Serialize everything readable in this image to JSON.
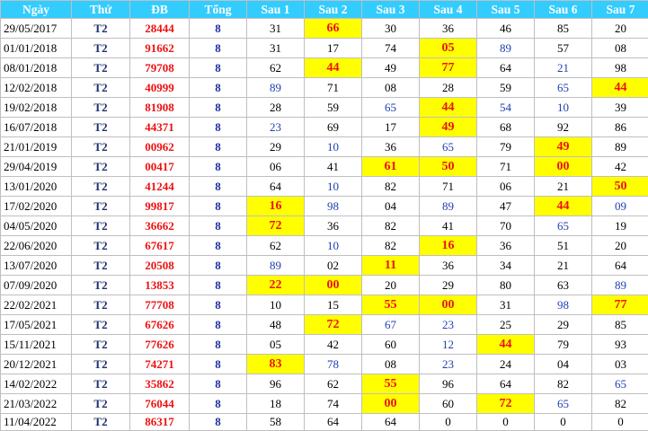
{
  "columns": [
    "Ngày",
    "Thứ",
    "ĐB",
    "Tổng",
    "Sau 1",
    "Sau 2",
    "Sau 3",
    "Sau 4",
    "Sau 5",
    "Sau 6",
    "Sau 7"
  ],
  "colors": {
    "header_bg": "#33ccff",
    "highlight_bg": "#ffff00",
    "highlight_text": "#ee1111",
    "db_text": "#ee1111",
    "tong_text": "#1f2fa0",
    "blue_number": "#1f3fb0"
  },
  "rows": [
    {
      "date": "29/05/2017",
      "thu": "T2",
      "db": "28444",
      "tong": "8",
      "sau": [
        "31",
        "66",
        "30",
        "36",
        "46",
        "85",
        "20"
      ],
      "hl": [
        1
      ],
      "blue": []
    },
    {
      "date": "01/01/2018",
      "thu": "T2",
      "db": "91662",
      "tong": "8",
      "sau": [
        "31",
        "17",
        "74",
        "05",
        "89",
        "57",
        "08"
      ],
      "hl": [
        3
      ],
      "blue": [
        4
      ]
    },
    {
      "date": "08/01/2018",
      "thu": "T2",
      "db": "79708",
      "tong": "8",
      "sau": [
        "62",
        "44",
        "49",
        "77",
        "64",
        "21",
        "98"
      ],
      "hl": [
        1,
        3
      ],
      "blue": [
        5
      ]
    },
    {
      "date": "12/02/2018",
      "thu": "T2",
      "db": "40999",
      "tong": "8",
      "sau": [
        "89",
        "71",
        "08",
        "28",
        "59",
        "65",
        "44"
      ],
      "hl": [
        6
      ],
      "blue": [
        0,
        5
      ]
    },
    {
      "date": "19/02/2018",
      "thu": "T2",
      "db": "81908",
      "tong": "8",
      "sau": [
        "28",
        "59",
        "65",
        "44",
        "54",
        "10",
        "39"
      ],
      "hl": [
        3
      ],
      "blue": [
        2,
        4,
        5
      ]
    },
    {
      "date": "16/07/2018",
      "thu": "T2",
      "db": "44371",
      "tong": "8",
      "sau": [
        "23",
        "69",
        "17",
        "49",
        "68",
        "92",
        "86"
      ],
      "hl": [
        3
      ],
      "blue": [
        0
      ]
    },
    {
      "date": "21/01/2019",
      "thu": "T2",
      "db": "00962",
      "tong": "8",
      "sau": [
        "29",
        "10",
        "36",
        "65",
        "79",
        "49",
        "89"
      ],
      "hl": [
        5
      ],
      "blue": [
        1,
        3
      ]
    },
    {
      "date": "29/04/2019",
      "thu": "T2",
      "db": "00417",
      "tong": "8",
      "sau": [
        "06",
        "41",
        "61",
        "50",
        "71",
        "00",
        "42"
      ],
      "hl": [
        2,
        3,
        5
      ],
      "blue": []
    },
    {
      "date": "13/01/2020",
      "thu": "T2",
      "db": "41244",
      "tong": "8",
      "sau": [
        "64",
        "10",
        "82",
        "71",
        "06",
        "21",
        "50"
      ],
      "hl": [
        6
      ],
      "blue": [
        1
      ]
    },
    {
      "date": "17/02/2020",
      "thu": "T2",
      "db": "99817",
      "tong": "8",
      "sau": [
        "16",
        "98",
        "04",
        "89",
        "47",
        "44",
        "09"
      ],
      "hl": [
        0,
        5
      ],
      "blue": [
        1,
        3,
        6
      ]
    },
    {
      "date": "04/05/2020",
      "thu": "T2",
      "db": "36662",
      "tong": "8",
      "sau": [
        "72",
        "36",
        "82",
        "41",
        "70",
        "65",
        "19"
      ],
      "hl": [
        0
      ],
      "blue": [
        5
      ]
    },
    {
      "date": "22/06/2020",
      "thu": "T2",
      "db": "67617",
      "tong": "8",
      "sau": [
        "62",
        "10",
        "82",
        "16",
        "36",
        "51",
        "20"
      ],
      "hl": [
        3
      ],
      "blue": [
        1
      ]
    },
    {
      "date": "13/07/2020",
      "thu": "T2",
      "db": "20508",
      "tong": "8",
      "sau": [
        "89",
        "02",
        "11",
        "36",
        "34",
        "21",
        "64"
      ],
      "hl": [
        2
      ],
      "blue": [
        0
      ]
    },
    {
      "date": "07/09/2020",
      "thu": "T2",
      "db": "13853",
      "tong": "8",
      "sau": [
        "22",
        "00",
        "20",
        "29",
        "80",
        "63",
        "89"
      ],
      "hl": [
        0,
        1
      ],
      "blue": [
        6
      ]
    },
    {
      "date": "22/02/2021",
      "thu": "T2",
      "db": "77708",
      "tong": "8",
      "sau": [
        "10",
        "15",
        "55",
        "00",
        "31",
        "98",
        "77"
      ],
      "hl": [
        2,
        3,
        6
      ],
      "blue": [
        5
      ]
    },
    {
      "date": "17/05/2021",
      "thu": "T2",
      "db": "67626",
      "tong": "8",
      "sau": [
        "48",
        "72",
        "67",
        "23",
        "25",
        "29",
        "85"
      ],
      "hl": [
        1
      ],
      "blue": [
        2,
        3
      ]
    },
    {
      "date": "15/11/2021",
      "thu": "T2",
      "db": "77626",
      "tong": "8",
      "sau": [
        "05",
        "42",
        "60",
        "12",
        "44",
        "79",
        "93"
      ],
      "hl": [
        4
      ],
      "blue": [
        3
      ]
    },
    {
      "date": "20/12/2021",
      "thu": "T2",
      "db": "74271",
      "tong": "8",
      "sau": [
        "83",
        "78",
        "08",
        "23",
        "24",
        "04",
        "03"
      ],
      "hl": [
        0
      ],
      "blue": [
        1,
        3
      ]
    },
    {
      "date": "14/02/2022",
      "thu": "T2",
      "db": "35862",
      "tong": "8",
      "sau": [
        "96",
        "62",
        "55",
        "96",
        "64",
        "82",
        "65"
      ],
      "hl": [
        2
      ],
      "blue": [
        6
      ]
    },
    {
      "date": "21/03/2022",
      "thu": "T2",
      "db": "76044",
      "tong": "8",
      "sau": [
        "18",
        "74",
        "00",
        "60",
        "72",
        "65",
        "82"
      ],
      "hl": [
        2,
        4
      ],
      "blue": [
        5
      ]
    },
    {
      "date": "11/04/2022",
      "thu": "T2",
      "db": "86317",
      "tong": "8",
      "sau": [
        "58",
        "64",
        "64",
        "0",
        "0",
        "0",
        "0"
      ],
      "hl": [],
      "blue": []
    }
  ]
}
